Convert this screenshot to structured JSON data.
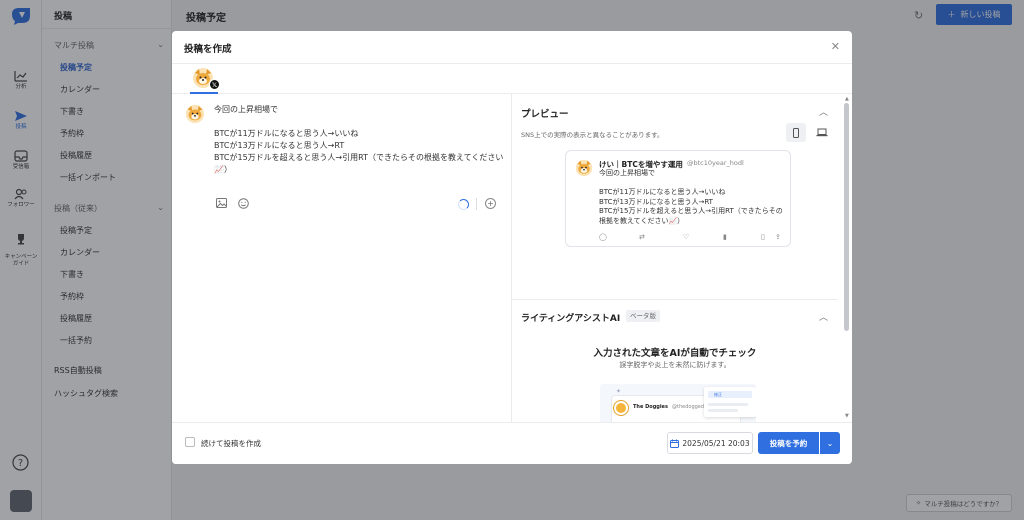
{
  "sidebar": {
    "title": "投稿",
    "rail": [
      {
        "label": "分析",
        "icon": "chart-icon"
      },
      {
        "label": "投稿",
        "icon": "send-icon"
      },
      {
        "label": "受信箱",
        "icon": "inbox-icon"
      },
      {
        "label": "フォロワー",
        "icon": "followers-icon"
      },
      {
        "label": "キャンペーン\nガイド",
        "icon": "trophy-icon"
      }
    ],
    "group_multi": "マルチ投稿",
    "multi_items": [
      "投稿予定",
      "カレンダー",
      "下書き",
      "予約枠",
      "投稿履歴",
      "一括インポート"
    ],
    "group_legacy": "投稿（従来）",
    "legacy_items": [
      "投稿予定",
      "カレンダー",
      "下書き",
      "予約枠",
      "投稿履歴",
      "一括予約"
    ],
    "rss": "RSS自動投稿",
    "hashtag": "ハッシュタグ検索"
  },
  "topbar": {
    "title": "投稿予定",
    "new_post": "新しい投稿"
  },
  "floating": {
    "label": "マルチ投稿はどうですか？"
  },
  "modal": {
    "title": "投稿を作成",
    "editor_text": "今回の上昇相場で\n\nBTCが11万ドルになると思う人→いいね\nBTCが13万ドルになると思う人→RT\nBTCが15万ドルを超えると思う人→引用RT（できたらその根拠を教えてください📈）",
    "preview": {
      "title": "プレビュー",
      "note": "SNS上での実際の表示と異なることがあります。",
      "tweet_name": "けい｜BTCを増やす運用",
      "tweet_handle": "@btc10year_hodl",
      "tweet_text": "今回の上昇相場で\n\nBTCが11万ドルになると思う人→いいね\nBTCが13万ドルになると思う人→RT\nBTCが15万ドルを超えると思う人→引用RT（できたらその根拠を教えてください📈）"
    },
    "ai": {
      "title": "ライティングアシストAI",
      "badge": "ベータ版",
      "heading": "入力された文章をAIが自動でチェック",
      "sub": "誤字脱字や炎上を未然に防げます。",
      "mock_name": "The Doggies",
      "mock_handle": "@thedoggeds",
      "mock_chip": "修正"
    },
    "footer": {
      "continue_label": "続けて投稿を作成",
      "date": "2025/05/21 20:03",
      "schedule_label": "投稿を予約"
    }
  },
  "colors": {
    "accent": "#2f6fe0",
    "overlay": "#1e2228"
  }
}
